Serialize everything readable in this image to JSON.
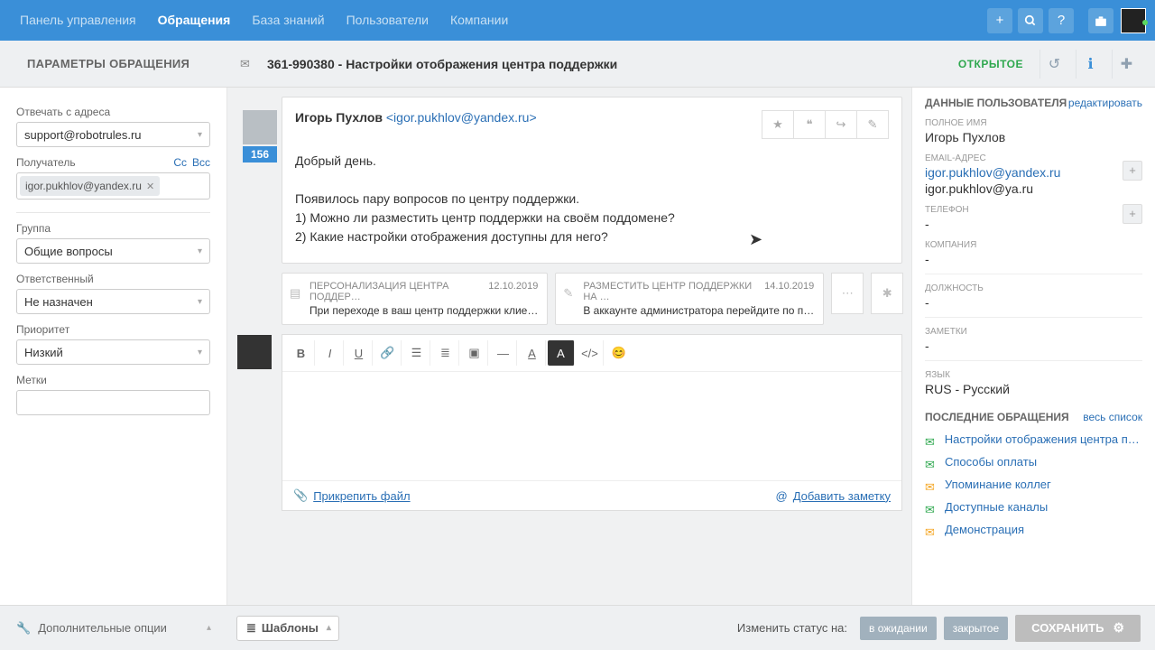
{
  "nav": {
    "items": [
      "Панель управления",
      "Обращения",
      "База знаний",
      "Пользователи",
      "Компании"
    ],
    "active_index": 1
  },
  "ticket": {
    "number": "361-990380",
    "title": "Настройки отображения центра поддержки",
    "status": "ОТКРЫТОЕ"
  },
  "left": {
    "heading": "ПАРАМЕТРЫ ОБРАЩЕНИЯ",
    "reply_from_label": "Отвечать с адреса",
    "reply_from_value": "support@robotrules.ru",
    "recipient_label": "Получатель",
    "cc": "Cc",
    "bcc": "Bcc",
    "recipient_chip": "igor.pukhlov@yandex.ru",
    "group_label": "Группа",
    "group_value": "Общие вопросы",
    "assignee_label": "Ответственный",
    "assignee_value": "Не назначен",
    "priority_label": "Приоритет",
    "priority_value": "Низкий",
    "tags_label": "Метки"
  },
  "message": {
    "badge": "156",
    "from_name": "Игорь Пухлов",
    "from_email": "<igor.pukhlov@yandex.ru>",
    "body_line1": "Добрый день.",
    "body_line2": "Появилось пару вопросов по центру поддержки.",
    "body_line3": "1) Можно ли разместить центр поддержки на своём поддомене?",
    "body_line4": "2) Какие настройки отображения доступны для него?"
  },
  "related": [
    {
      "title": "ПЕРСОНАЛИЗАЦИЯ ЦЕНТРА ПОДДЕР…",
      "date": "12.10.2019",
      "sub": "При переходе в ваш центр поддержки клие…"
    },
    {
      "title": "РАЗМЕСТИТЬ ЦЕНТР ПОДДЕРЖКИ НА …",
      "date": "14.10.2019",
      "sub": "В аккаунте администратора перейдите по п…"
    }
  ],
  "editor": {
    "attach": "Прикрепить файл",
    "add_note": "Добавить заметку"
  },
  "right": {
    "heading": "ДАННЫЕ ПОЛЬЗОВАТЕЛЯ",
    "edit": "редактировать",
    "full_name_label": "ПОЛНОЕ ИМЯ",
    "full_name_value": "Игорь Пухлов",
    "email_label": "EMAIL-АДРЕС",
    "email1": "igor.pukhlov@yandex.ru",
    "email2": "igor.pukhlov@ya.ru",
    "phone_label": "ТЕЛЕФОН",
    "phone_value": "-",
    "company_label": "КОМПАНИЯ",
    "company_value": "-",
    "position_label": "ДОЛЖНОСТЬ",
    "position_value": "-",
    "notes_label": "ЗАМЕТКИ",
    "notes_value": "-",
    "lang_label": "ЯЗЫК",
    "lang_value": "RUS - Русский",
    "recent_heading": "ПОСЛЕДНИЕ ОБРАЩЕНИЯ",
    "recent_all": "весь список",
    "recent": [
      {
        "color": "#2fa84f",
        "text": "Настройки отображения центра по…"
      },
      {
        "color": "#2fa84f",
        "text": "Способы оплаты"
      },
      {
        "color": "#f5a623",
        "text": "Упоминание коллег"
      },
      {
        "color": "#2fa84f",
        "text": "Доступные каналы"
      },
      {
        "color": "#f5a623",
        "text": "Демонстрация"
      }
    ]
  },
  "bottom": {
    "more_options": "Дополнительные опции",
    "templates": "Шаблоны",
    "change_status_label": "Изменить статус на:",
    "status_pending": "в ожидании",
    "status_closed": "закрытое",
    "save": "СОХРАНИТЬ"
  }
}
